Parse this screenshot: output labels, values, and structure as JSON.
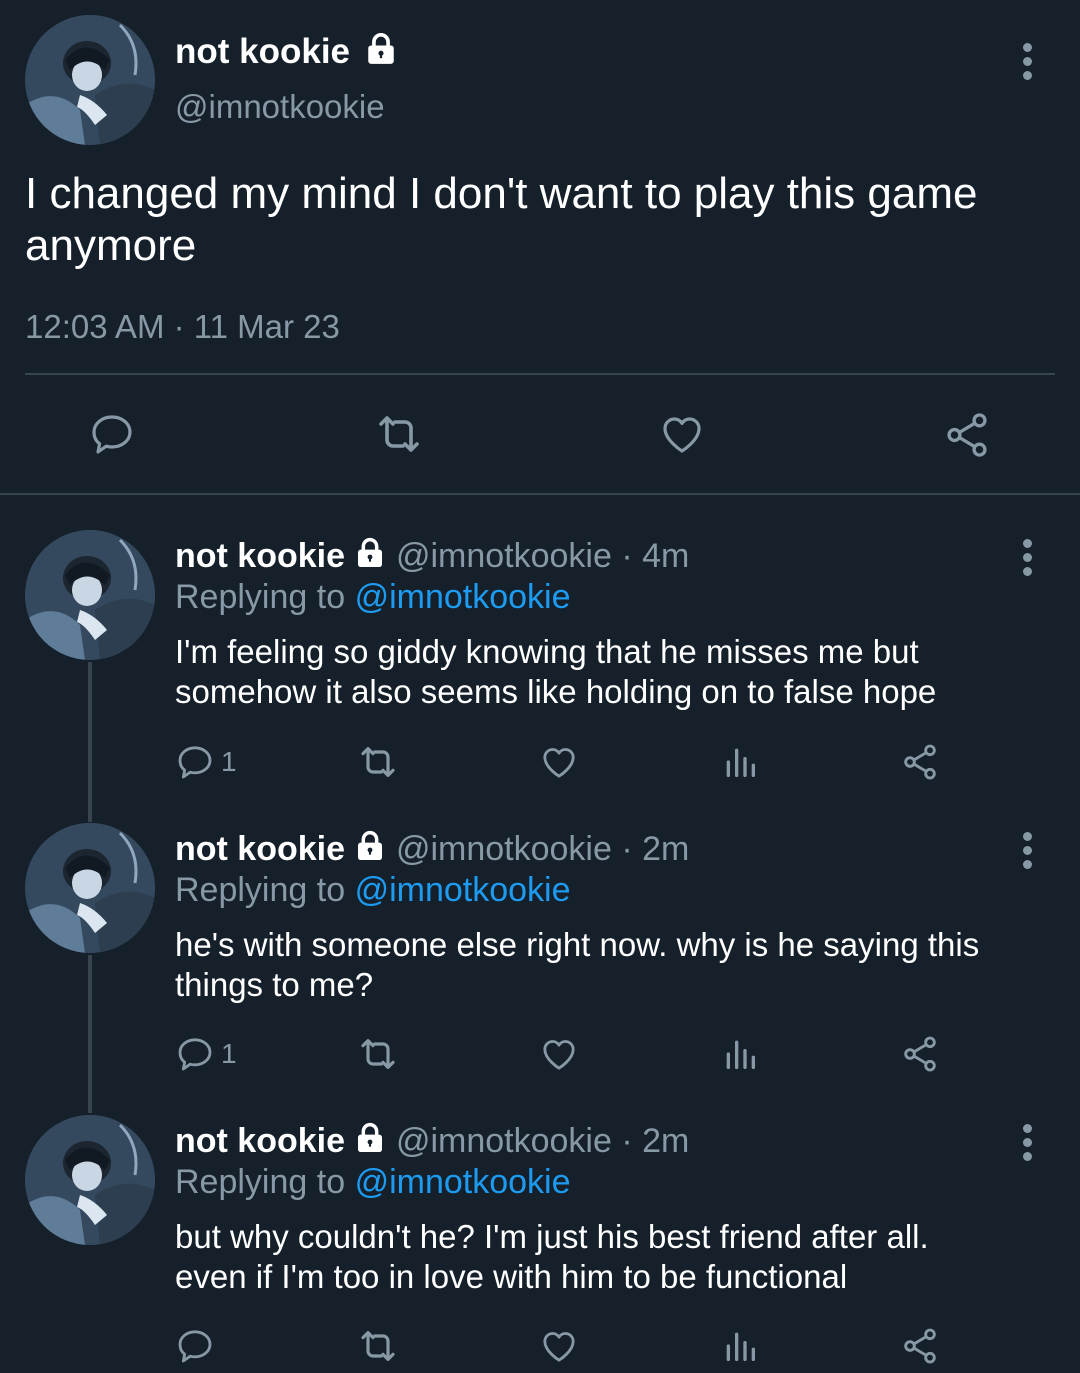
{
  "main_tweet": {
    "display_name": "not kookie",
    "handle": "@imnotkookie",
    "text": "I changed my mind I don't want to play this game anymore",
    "timestamp": "12:03 AM · 11 Mar 23"
  },
  "replies": [
    {
      "display_name": "not kookie",
      "handle_time": "@imnotkookie · 4m",
      "replying_prefix": "Replying to",
      "replying_handle": "@imnotkookie",
      "text_line1": "I'm feeling so giddy knowing that he misses me but",
      "text_line2": "somehow it also seems like holding on to false hope",
      "reply_count": "1"
    },
    {
      "display_name": "not kookie",
      "handle_time": "@imnotkookie · 2m",
      "replying_prefix": "Replying to",
      "replying_handle": "@imnotkookie",
      "text_line1": "he's with someone else right now. why is he saying this",
      "text_line2": "things to me?",
      "reply_count": "1"
    },
    {
      "display_name": "not kookie",
      "handle_time": "@imnotkookie · 2m",
      "replying_prefix": "Replying to",
      "replying_handle": "@imnotkookie",
      "text_line1": "but why couldn't he? I'm just his best friend after all.",
      "text_line2": "even if I'm too in love with him to be functional",
      "reply_count": ""
    }
  ],
  "icons": {
    "lock": "lock-icon",
    "more": "more-options-icon",
    "reply": "reply-icon",
    "retweet": "retweet-icon",
    "like": "like-icon",
    "views": "views-icon",
    "share": "share-icon"
  },
  "colors": {
    "background": "#15202b",
    "muted": "#8899a6",
    "link": "#1d9bf0",
    "divider": "#38444d"
  }
}
